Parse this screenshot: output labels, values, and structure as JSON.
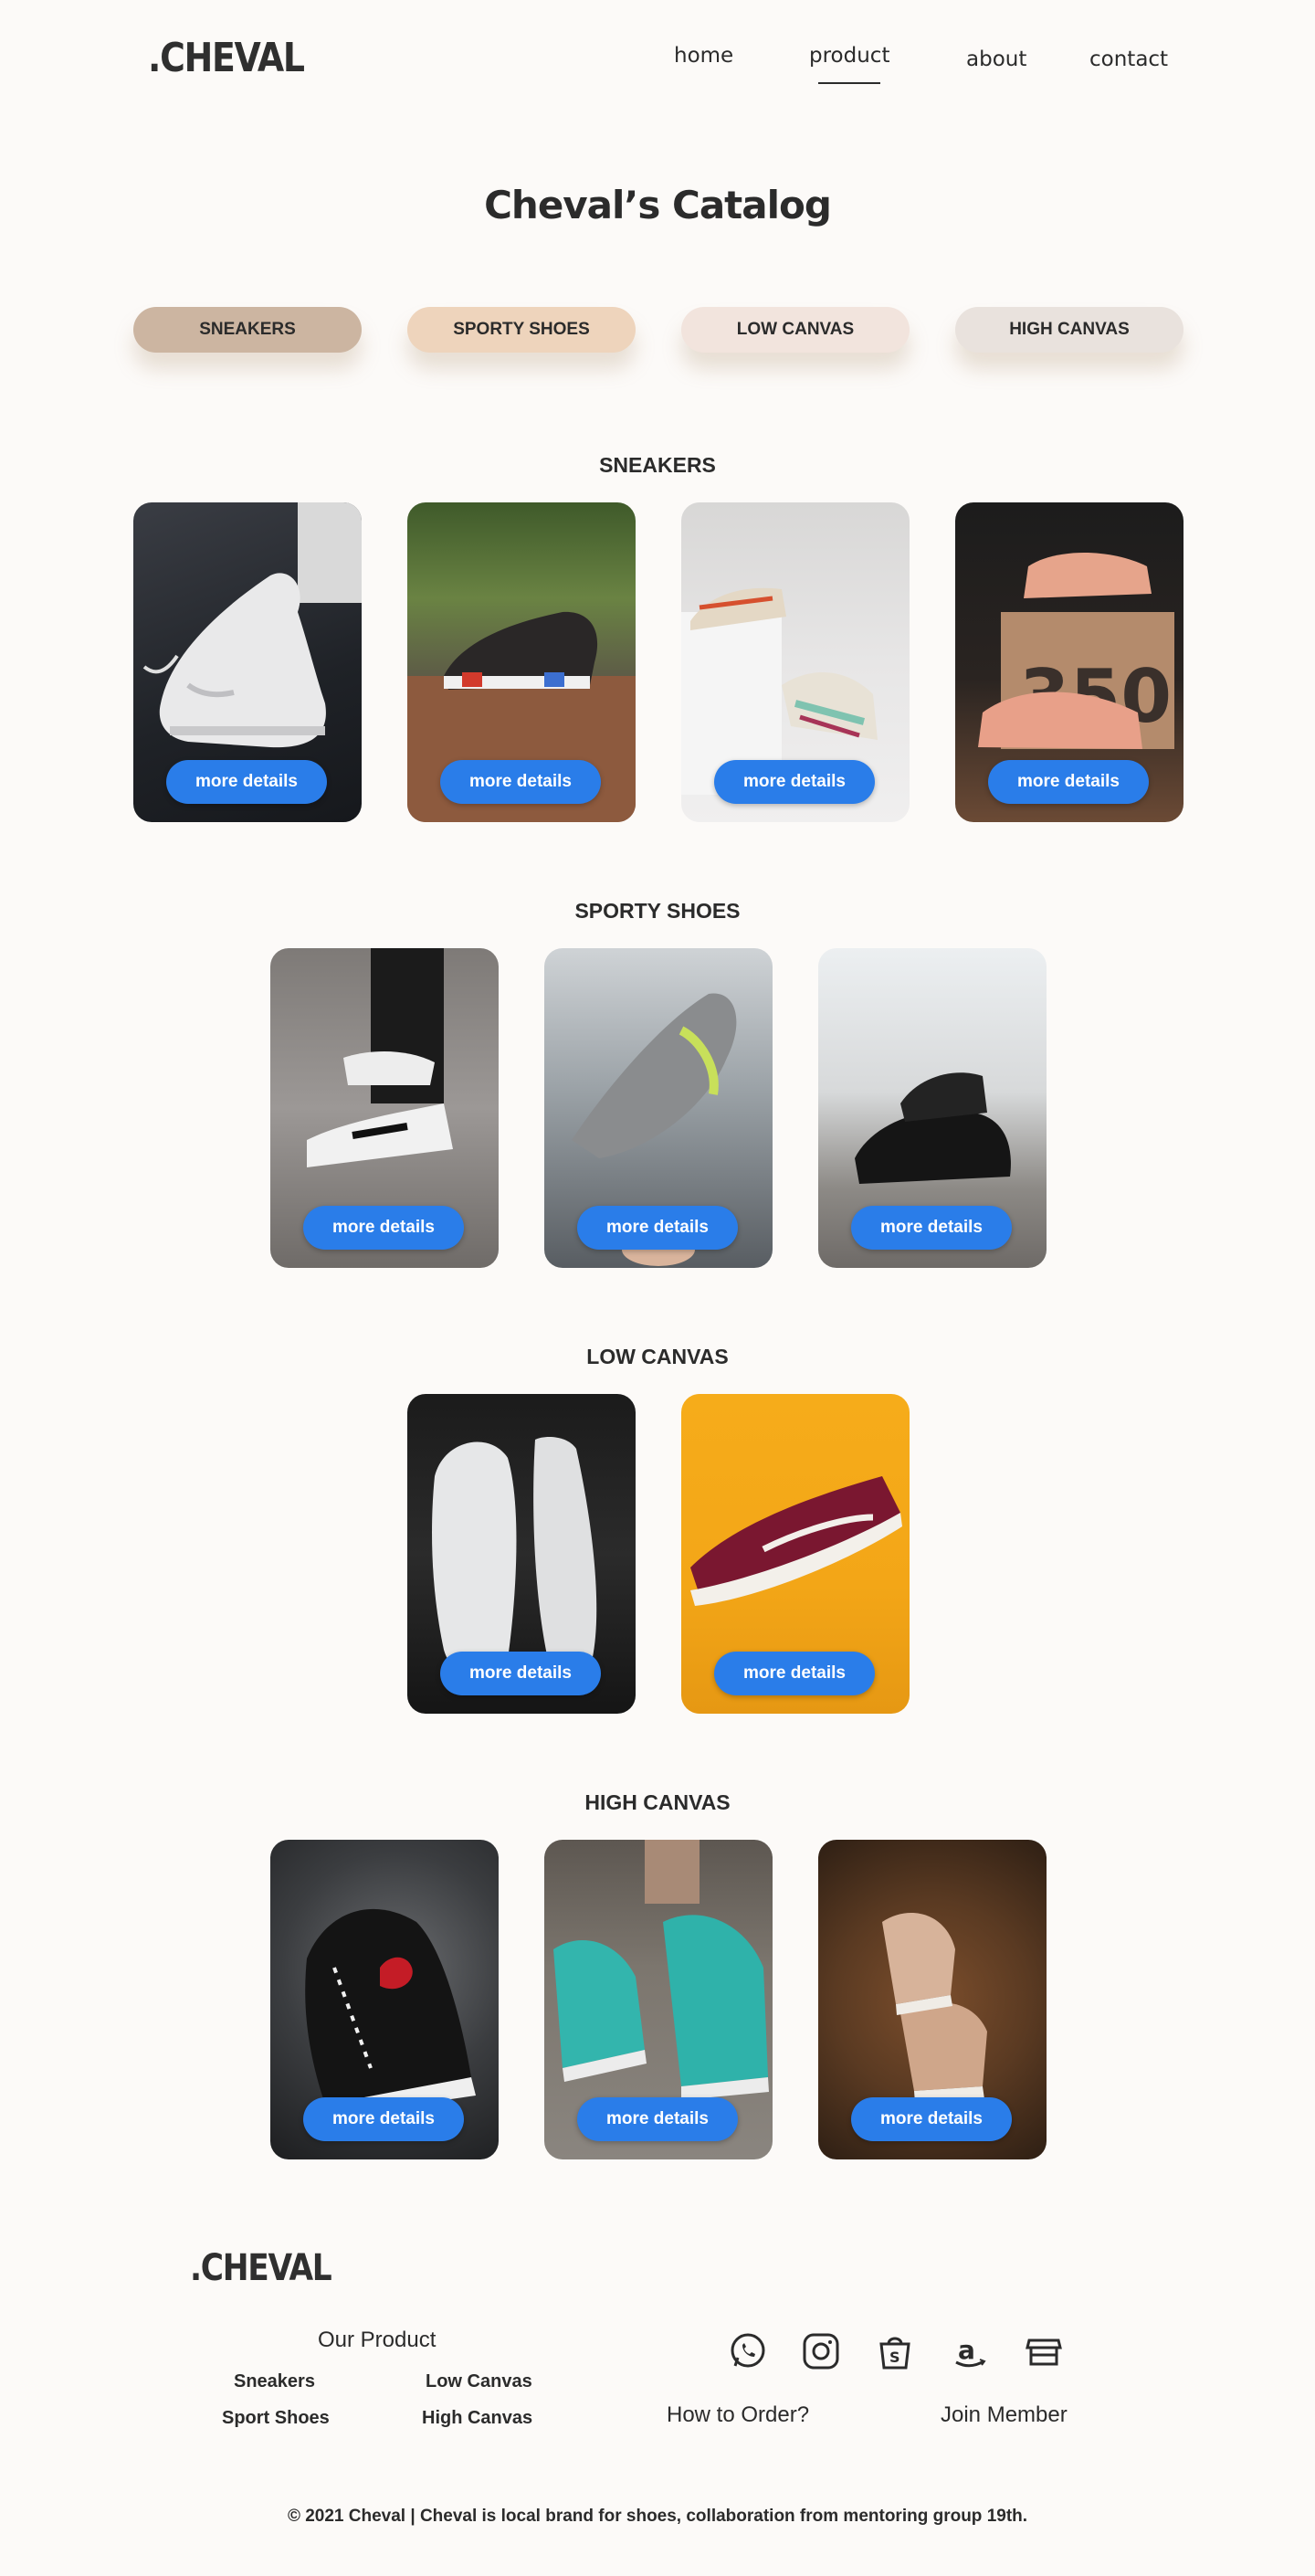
{
  "header": {
    "logo": ".CHEVAL",
    "nav": [
      {
        "label": "home"
      },
      {
        "label": "product"
      },
      {
        "label": "about"
      },
      {
        "label": "contact"
      }
    ]
  },
  "catalog_title": "Cheval’s Catalog",
  "categories": [
    {
      "label": "SNEAKERS",
      "color": "#ccb5a1"
    },
    {
      "label": "SPORTY SHOES",
      "color": "#eed4bc"
    },
    {
      "label": "LOW CANVAS",
      "color": "#f2e4dd"
    },
    {
      "label": "HIGH CANVAS",
      "color": "#e9e2dd"
    }
  ],
  "button_label": "more details",
  "sections": [
    {
      "title": "SNEAKERS",
      "products": [
        {
          "name": "white nike air force sneaker"
        },
        {
          "name": "black adidas nmd sneaker"
        },
        {
          "name": "multicolor sneakers on white block"
        },
        {
          "name": "yeezy 350 pink sneakers"
        }
      ]
    },
    {
      "title": "SPORTY SHOES",
      "products": [
        {
          "name": "white nike air max on stairs"
        },
        {
          "name": "grey knit running shoe"
        },
        {
          "name": "black trail running shoes"
        }
      ]
    },
    {
      "title": "LOW CANVAS",
      "products": [
        {
          "name": "white low canvas shoes"
        },
        {
          "name": "maroon vans old skool"
        }
      ]
    },
    {
      "title": "HIGH CANVAS",
      "products": [
        {
          "name": "black comme des garcons high top"
        },
        {
          "name": "teal converse high tops"
        },
        {
          "name": "tan vans sk8-hi on leaves"
        }
      ]
    }
  ],
  "footer": {
    "logo": ".CHEVAL",
    "our_product": "Our Product",
    "links": [
      "Sneakers",
      "Low Canvas",
      "Sport Shoes",
      "High Canvas"
    ],
    "how_to_order": "How to Order?",
    "join_member": "Join Member",
    "social_icons": [
      "whatsapp-icon",
      "instagram-icon",
      "shopee-icon",
      "amazon-icon",
      "store-icon"
    ],
    "copyright": "© 2021 Cheval | Cheval is local brand for shoes, collaboration from mentoring group 19th."
  }
}
